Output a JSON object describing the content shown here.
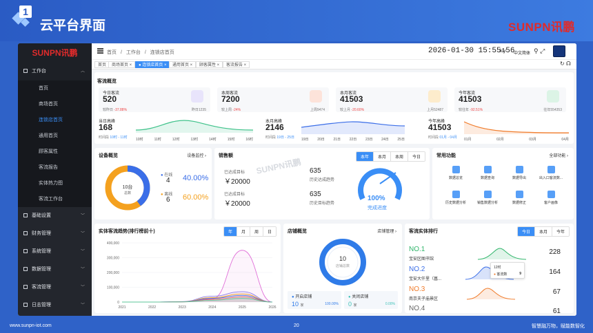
{
  "slide": {
    "number": "1",
    "title": "云平台界面",
    "brand": "SUNPN讯鹏",
    "footer_url": "www.sunpn-iot.com",
    "page": "20",
    "slogan": "智慧融万物，赋能数智化"
  },
  "sidebar": {
    "logo": "SUNPN讯鹏",
    "group_workbench": "工作台",
    "items": [
      "首页",
      "商场首页",
      "连锁店首页",
      "通用首页",
      "顾客属性",
      "客流报告",
      "实体热力图",
      "客流工作台"
    ],
    "groups": [
      "基础设置",
      "财务管理",
      "系统管理",
      "数据管理",
      "客流管理",
      "日志管理"
    ]
  },
  "topbar": {
    "crumbs": [
      "首页",
      "/",
      "工作台",
      "/",
      "连锁店首页"
    ],
    "datetime": "2026-01-30 15:55:56",
    "user": "kly",
    "lang": "中文简体"
  },
  "tabs": [
    {
      "label": "首页"
    },
    {
      "label": "商场首页 ×"
    },
    {
      "label": "● 连锁店首页 ×"
    },
    {
      "label": "通用首页 ×"
    },
    {
      "label": "顾客属性 ×"
    },
    {
      "label": "客流报告 ×"
    }
  ],
  "kpi": {
    "title": "客流概览",
    "cards": [
      {
        "label": "今日客流",
        "value": "520",
        "cmp_label": "较昨日",
        "cmp": "-37.88%",
        "right": "昨日1235",
        "color": "#8a7be8"
      },
      {
        "label": "本周客流",
        "value": "7200",
        "cmp_label": "较上周",
        "cmp": "-24%",
        "right": "上周9474",
        "color": "#f07b5a"
      },
      {
        "label": "本月客流",
        "value": "41503",
        "cmp_label": "较上月",
        "cmp": "-20.60%",
        "right": "上月52487",
        "color": "#f4b533"
      },
      {
        "label": "今年客流",
        "value": "41503",
        "cmp_label": "较往年",
        "cmp": "-92.51%",
        "right": "往年554353",
        "color": "#4fc38a"
      }
    ],
    "trends": [
      {
        "label": "当日高峰",
        "value": "168",
        "period_label": "时间段",
        "period": "10时 - 11时",
        "ticks": [
          "10时",
          "11时",
          "12时",
          "13时",
          "14时",
          "15时",
          "16时"
        ]
      },
      {
        "label": "本月高峰",
        "value": "2146",
        "period_label": "时间段",
        "period": "19日 - 25日",
        "ticks": [
          "19日",
          "20日",
          "21日",
          "22日",
          "23日",
          "24日",
          "25日"
        ]
      },
      {
        "label": "今年高峰",
        "value": "41503",
        "period_label": "时间段",
        "period": "01月 - 04月",
        "ticks": [
          "01月",
          "02月",
          "03月",
          "04月"
        ]
      }
    ]
  },
  "devices": {
    "title": "设备概览",
    "link": "设备监控 ›",
    "center_value": "10台",
    "center_label": "总数",
    "online_label": "在线",
    "online": "4",
    "online_pct": "40.00%",
    "offline_label": "离线",
    "offline": "6",
    "offline_pct": "60.00%",
    "online_color": "#3a6ee8",
    "offline_color": "#f4a11f"
  },
  "sales": {
    "title": "销售额",
    "periods": [
      "本年",
      "本月",
      "本周",
      "今日"
    ],
    "active_period": "本年",
    "watermark": "SUNPN讯鹏",
    "achieved_label": "已达成目标",
    "achieved": "￥20000",
    "target_label": "已达成目标",
    "target": "￥20000",
    "trend_value": "635",
    "trend_label": "历史达成趋势",
    "hist_value": "635",
    "hist_label": "历史目标趋势",
    "gauge_value": "100%",
    "gauge_label": "完成进度"
  },
  "functions": {
    "title": "常用功能",
    "link": "全部功能 ›",
    "items": [
      "数据总览",
      "数据查询",
      "数据导出",
      "出入口客流数...",
      "历史数据分析",
      "销售数据分析",
      "数据修正",
      "客户画像"
    ]
  },
  "chart_data": {
    "type": "line",
    "title": "实体客流趋势(排行榜前十)",
    "periods": [
      "年",
      "月",
      "周",
      "日"
    ],
    "x": [
      "2021",
      "2022",
      "2023",
      "2024",
      "2025",
      "2026"
    ],
    "yticks": [
      "400,000",
      "300,000",
      "200,000",
      "100,000",
      "0"
    ],
    "ylim": [
      0,
      400000
    ],
    "series": [
      {
        "color": "#e070d8",
        "values": [
          0,
          0,
          2000,
          22000,
          350000,
          0
        ]
      },
      {
        "color": "#8b7ee8",
        "values": [
          0,
          0,
          3000,
          40000,
          70000,
          0
        ]
      },
      {
        "color": "#f4a11f",
        "values": [
          0,
          0,
          2000,
          30000,
          55000,
          0
        ]
      },
      {
        "color": "#4a6ee8",
        "values": [
          0,
          0,
          1500,
          25000,
          45000,
          0
        ]
      },
      {
        "color": "#e46a6a",
        "values": [
          0,
          0,
          1000,
          18000,
          35000,
          0
        ]
      },
      {
        "color": "#5bc49a",
        "values": [
          0,
          0,
          800,
          12000,
          25000,
          0
        ]
      }
    ]
  },
  "stores": {
    "title": "店铺概览",
    "link": "店铺管理 ›",
    "total": "10",
    "total_label": "店铺总数",
    "open_label": "开启店铺",
    "open": "10",
    "open_unit": "家",
    "open_pct": "100.00%",
    "closed_label": "关闭店铺",
    "closed": "0",
    "closed_unit": "家",
    "closed_pct": "0.00%"
  },
  "ranking": {
    "title": "客流实体排行",
    "periods": [
      "今日",
      "本月",
      "今年"
    ],
    "rows": [
      {
        "no": "NO.1",
        "name": "宝安区图书馆",
        "count": "228",
        "color": "#2fb56a"
      },
      {
        "no": "NO.2",
        "name": "宝安大仟里（菖...",
        "count": "164",
        "color": "#3a6ee8"
      },
      {
        "no": "NO.3",
        "name": "南京夫子庙景区",
        "count": "67",
        "color": "#f07b2a"
      },
      {
        "no": "NO.4",
        "name": "",
        "count": "61",
        "color": "#666"
      }
    ],
    "tooltip_time": "12时",
    "tooltip_label": "客流数",
    "tooltip_value": "9"
  }
}
